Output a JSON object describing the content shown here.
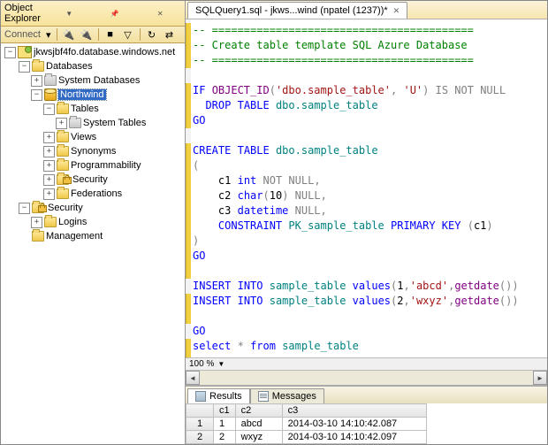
{
  "explorer": {
    "title": "Object Explorer",
    "connect_label": "Connect",
    "root": "jkwsjbf4fo.database.windows.net",
    "nodes": {
      "databases": "Databases",
      "system_databases": "System Databases",
      "northwind": "Northwind",
      "tables": "Tables",
      "system_tables": "System Tables",
      "views": "Views",
      "synonyms": "Synonyms",
      "programmability": "Programmability",
      "security_db": "Security",
      "federations": "Federations",
      "security_srv": "Security",
      "logins": "Logins",
      "management": "Management"
    }
  },
  "tabs": {
    "main": "SQLQuery1.sql - jkws...wind (npatel (1237))*"
  },
  "code": {
    "l1": "-- =========================================",
    "l2": "-- Create table template SQL Azure Database",
    "l3": "-- =========================================",
    "if": "IF",
    "objectid": "OBJECT_ID",
    "args": "'dbo.sample_table'",
    "argu": "'U'",
    "isnotnull": "IS NOT NULL",
    "drop": "DROP",
    "table": "TABLE",
    "obj": "dbo.sample_table",
    "go": "GO",
    "create": "CREATE",
    "c1": "c1",
    "int": "int",
    "notnull": "NOT NULL",
    "c2": "c2",
    "char": "char",
    "ten": "10",
    "null": "NULL",
    "c3": "c3",
    "datetime": "datetime",
    "constraint": "CONSTRAINT",
    "pk": "PK_sample_table",
    "primarykey": "PRIMARY KEY",
    "insert": "INSERT",
    "into": "INTO",
    "st": "sample_table",
    "values": "values",
    "v1": "1",
    "s1": "'abcd'",
    "getdate": "getdate",
    "v2": "2",
    "s2": "'wxyz'",
    "select": "select",
    "star": "*",
    "from": "from"
  },
  "zoom": "100 %",
  "results": {
    "tab_results": "Results",
    "tab_messages": "Messages",
    "cols": {
      "c1": "c1",
      "c2": "c2",
      "c3": "c3"
    },
    "rows": [
      {
        "n": "1",
        "c1": "1",
        "c2": "abcd",
        "c3": "2014-03-10 14:10:42.087"
      },
      {
        "n": "2",
        "c1": "2",
        "c2": "wxyz",
        "c3": "2014-03-10 14:10:42.097"
      }
    ]
  }
}
